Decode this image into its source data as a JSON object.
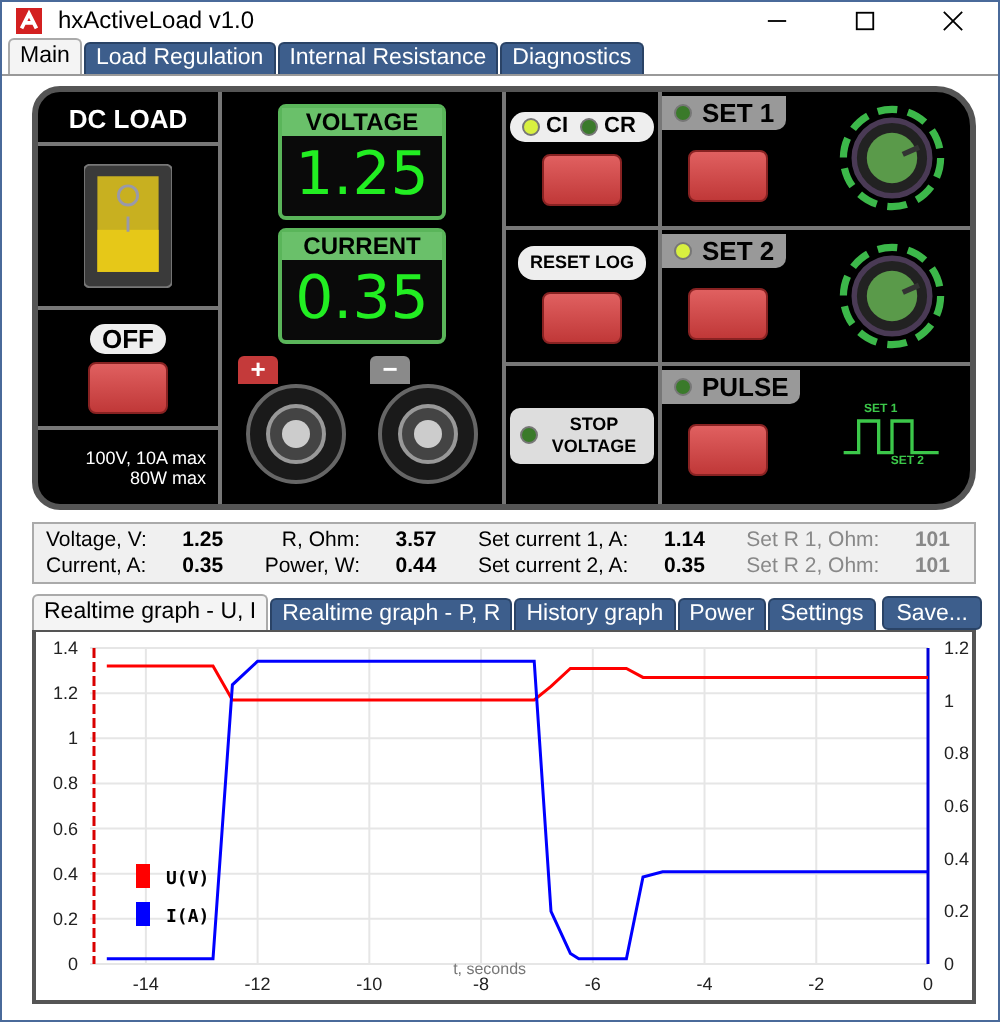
{
  "window": {
    "title": "hxActiveLoad v1.0"
  },
  "tabs": [
    {
      "label": "Main",
      "selected": true
    },
    {
      "label": "Load Regulation",
      "selected": false
    },
    {
      "label": "Internal Resistance",
      "selected": false
    },
    {
      "label": "Diagnostics",
      "selected": false
    }
  ],
  "device": {
    "title": "DC LOAD",
    "power_label": "OFF",
    "specs": [
      "100V, 10A max",
      "80W max"
    ],
    "switch_on": true,
    "displays": [
      {
        "label": "VOLTAGE",
        "value": "1.25"
      },
      {
        "label": "CURRENT",
        "value": "0.35"
      }
    ],
    "terminals": [
      {
        "sign": "+",
        "kind": "positive"
      },
      {
        "sign": "−",
        "kind": "negative"
      }
    ],
    "modes": [
      {
        "label": "CI",
        "on": true
      },
      {
        "label": "CR",
        "on": false
      }
    ],
    "reset_label": "RESET LOG",
    "stop": {
      "label": "STOP VOLTAGE",
      "on": false
    },
    "channels": [
      {
        "label": "SET 1",
        "on": false
      },
      {
        "label": "SET 2",
        "on": true
      },
      {
        "label": "PULSE",
        "on": false
      }
    ],
    "pulse_labels": [
      "SET 1",
      "SET 2"
    ]
  },
  "readouts": [
    {
      "label": "Voltage, V:",
      "value": "1.25",
      "disabled": false
    },
    {
      "label": "R, Ohm:",
      "value": "3.57",
      "disabled": false
    },
    {
      "label": "Set current 1, A:",
      "value": "1.14",
      "disabled": false
    },
    {
      "label": "Set R 1, Ohm:",
      "value": "101",
      "disabled": true
    },
    {
      "label": "Current, A:",
      "value": "0.35",
      "disabled": false
    },
    {
      "label": "Power, W:",
      "value": "0.44",
      "disabled": false
    },
    {
      "label": "Set current 2, A:",
      "value": "0.35",
      "disabled": false
    },
    {
      "label": "Set R 2, Ohm:",
      "value": "101",
      "disabled": true
    }
  ],
  "graph_tabs": [
    {
      "label": "Realtime graph - U, I",
      "selected": true
    },
    {
      "label": "Realtime graph - P, R",
      "selected": false
    },
    {
      "label": "History graph",
      "selected": false
    },
    {
      "label": "Power",
      "selected": false
    },
    {
      "label": "Settings",
      "selected": false
    }
  ],
  "save_button": "Save...",
  "chart_data": {
    "type": "line",
    "xlabel": "t, seconds",
    "x": [
      -14.7,
      -12.8,
      -12.45,
      -12.0,
      -7.05,
      -6.75,
      -6.4,
      -6.25,
      -5.4,
      -5.1,
      -4.75,
      0
    ],
    "grid": true,
    "legend": "lower left",
    "xlim": [
      -15,
      0
    ],
    "xticks": [
      -14,
      -12,
      -10,
      -8,
      -6,
      -4,
      -2,
      0
    ],
    "ylim": [
      0,
      1.4
    ],
    "yticks": [
      0,
      0.2,
      0.4,
      0.6,
      0.8,
      1,
      1.2,
      1.4
    ],
    "y2lim": [
      0,
      1.2
    ],
    "y2ticks": [
      0,
      0.2,
      0.4,
      0.6,
      0.8,
      1,
      1.2
    ],
    "series": [
      {
        "name": "U(V)",
        "color": "#ff0000",
        "values": [
          1.32,
          1.32,
          1.17,
          1.17,
          1.17,
          1.23,
          1.31,
          1.31,
          1.31,
          1.27,
          1.27,
          1.27
        ]
      },
      {
        "name": "I(A)",
        "color": "#0000ff",
        "axis": "y2",
        "values": [
          0.02,
          0.02,
          1.06,
          1.15,
          1.15,
          0.2,
          0.04,
          0.02,
          0.02,
          0.33,
          0.35,
          0.35
        ]
      }
    ]
  }
}
